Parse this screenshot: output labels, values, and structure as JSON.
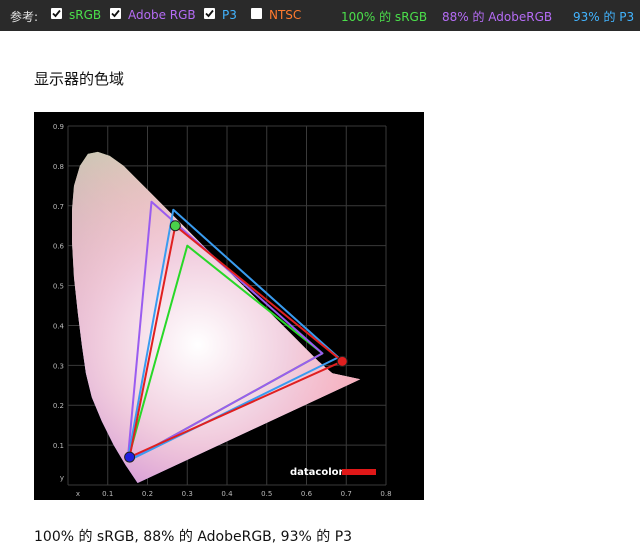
{
  "toolbar": {
    "label": "参考:",
    "options": [
      {
        "name": "srgb",
        "label": "sRGB",
        "checked": true,
        "color": "#4be04b"
      },
      {
        "name": "adobergb",
        "label": "Adobe RGB",
        "checked": true,
        "color": "#b56cf5"
      },
      {
        "name": "p3",
        "label": "P3",
        "checked": true,
        "color": "#42b4ff"
      },
      {
        "name": "ntsc",
        "label": "NTSC",
        "checked": false,
        "color": "#ff7a2e"
      }
    ],
    "stats": [
      {
        "name": "srgb",
        "text": "100% 的 sRGB",
        "color": "#4be04b"
      },
      {
        "name": "adobergb",
        "text": "88% 的 AdobeRGB",
        "color": "#b56cf5"
      },
      {
        "name": "p3",
        "text": "93% 的 P3",
        "color": "#42b4ff"
      }
    ]
  },
  "section_title": "显示器的色域",
  "caption": "100% 的 sRGB, 88% 的 AdobeRGB, 93% 的 P3",
  "chart_data": {
    "type": "scatter",
    "xlim": [
      0,
      0.8
    ],
    "ylim": [
      0,
      0.9
    ],
    "x_ticks": [
      "x",
      "0.1",
      "0.2",
      "0.3",
      "0.4",
      "0.5",
      "0.6",
      "0.7",
      "0.8"
    ],
    "y_ticks": [
      "y",
      "0.1",
      "0.2",
      "0.3",
      "0.4",
      "0.5",
      "0.6",
      "0.7",
      "0.8",
      "0.9"
    ],
    "grid": true,
    "logo": "datacolor",
    "series": [
      {
        "color": "#28d828",
        "x": [
          0.64,
          0.3,
          0.15
        ],
        "y": [
          0.33,
          0.6,
          0.06
        ]
      },
      {
        "color": "#9a5cf0",
        "x": [
          0.64,
          0.21,
          0.15
        ],
        "y": [
          0.33,
          0.71,
          0.06
        ]
      },
      {
        "color": "#3a9cf0",
        "x": [
          0.68,
          0.265,
          0.15
        ],
        "y": [
          0.32,
          0.69,
          0.06
        ]
      },
      {
        "color": "#e02020",
        "x": [
          0.69,
          0.27,
          0.155
        ],
        "y": [
          0.31,
          0.65,
          0.07
        ]
      }
    ],
    "primaries": [
      {
        "color": "#e02020",
        "x": 0.69,
        "y": 0.31
      },
      {
        "color": "#4ad24a",
        "x": 0.27,
        "y": 0.65
      },
      {
        "color": "#2020e0",
        "x": 0.155,
        "y": 0.07
      }
    ],
    "locus": {
      "x": [
        0.175,
        0.165,
        0.145,
        0.115,
        0.085,
        0.06,
        0.045,
        0.035,
        0.025,
        0.015,
        0.01,
        0.01,
        0.015,
        0.03,
        0.05,
        0.075,
        0.105,
        0.14,
        0.175,
        0.21,
        0.245,
        0.28,
        0.315,
        0.35,
        0.385,
        0.42,
        0.455,
        0.49,
        0.525,
        0.56,
        0.595,
        0.63,
        0.665,
        0.735,
        0.175
      ],
      "y": [
        0.005,
        0.02,
        0.05,
        0.1,
        0.16,
        0.22,
        0.28,
        0.35,
        0.43,
        0.52,
        0.61,
        0.69,
        0.75,
        0.8,
        0.83,
        0.835,
        0.825,
        0.8,
        0.765,
        0.73,
        0.695,
        0.66,
        0.625,
        0.59,
        0.555,
        0.52,
        0.485,
        0.45,
        0.415,
        0.38,
        0.345,
        0.31,
        0.28,
        0.265,
        0.005
      ]
    }
  }
}
